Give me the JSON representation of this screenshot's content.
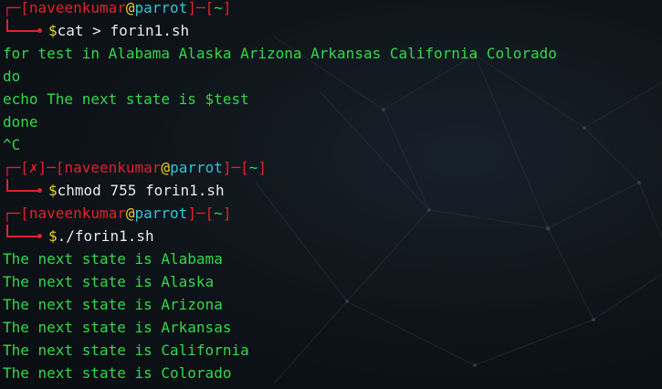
{
  "prompt": {
    "user": "naveenkumar",
    "at": "@",
    "host": "parrot",
    "dir": "~",
    "error_mark": "✗"
  },
  "commands": [
    "cat > forin1.sh",
    "chmod 755 forin1.sh",
    "./forin1.sh"
  ],
  "cat_input": [
    "for test in Alabama Alaska Arizona Arkansas California Colorado",
    "do",
    "echo The next state is $test",
    "done",
    "^C"
  ],
  "output": [
    "The next state is Alabama",
    "The next state is Alaska",
    "The next state is Arizona",
    "The next state is Arkansas",
    "The next state is California",
    "The next state is Colorado"
  ],
  "colors": {
    "text": "#32d84a",
    "prompt_frame": "#e1212d",
    "host": "#33c3d6",
    "at": "#f0d027",
    "dollar": "#f0d027",
    "background": "#0b1014"
  }
}
